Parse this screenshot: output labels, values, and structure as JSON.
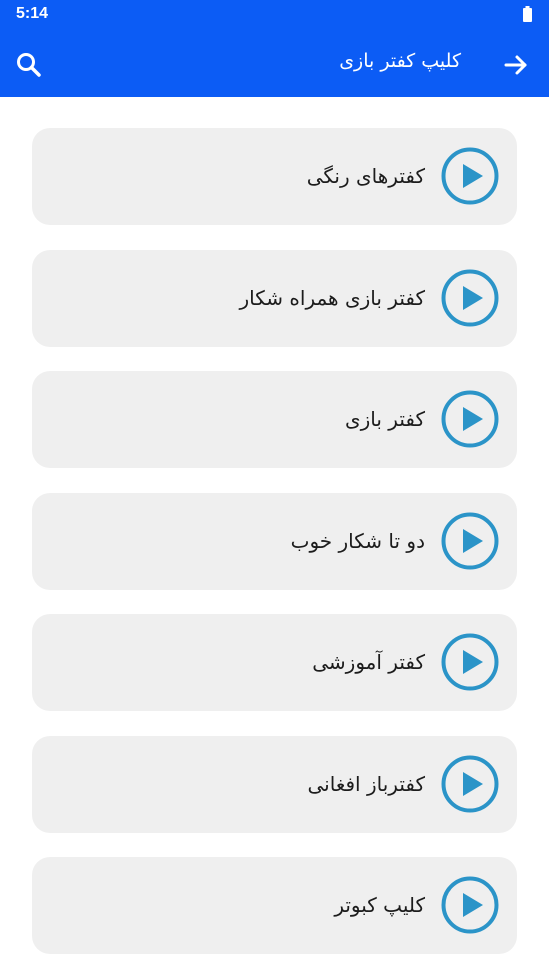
{
  "status_bar": {
    "time": "5:14"
  },
  "app_bar": {
    "title": "کلیپ کفتر بازی",
    "search_icon": "search-icon",
    "back_icon": "arrow-right-icon"
  },
  "colors": {
    "primary": "#0c5cf5",
    "play_icon": "#2b94c8",
    "card_bg": "#efefef"
  },
  "list": {
    "items": [
      {
        "label": "کفترهای رنگی",
        "icon": "play-circle-icon"
      },
      {
        "label": "کفتر بازی همراه شکار",
        "icon": "play-circle-icon"
      },
      {
        "label": "کفتر بازی",
        "icon": "play-circle-icon"
      },
      {
        "label": "دو تا شکار خوب",
        "icon": "play-circle-icon"
      },
      {
        "label": "کفتر آموزشی",
        "icon": "play-circle-icon"
      },
      {
        "label": "کفترباز افغانی",
        "icon": "play-circle-icon"
      },
      {
        "label": "کلیپ کبوتر",
        "icon": "play-circle-icon"
      }
    ]
  }
}
